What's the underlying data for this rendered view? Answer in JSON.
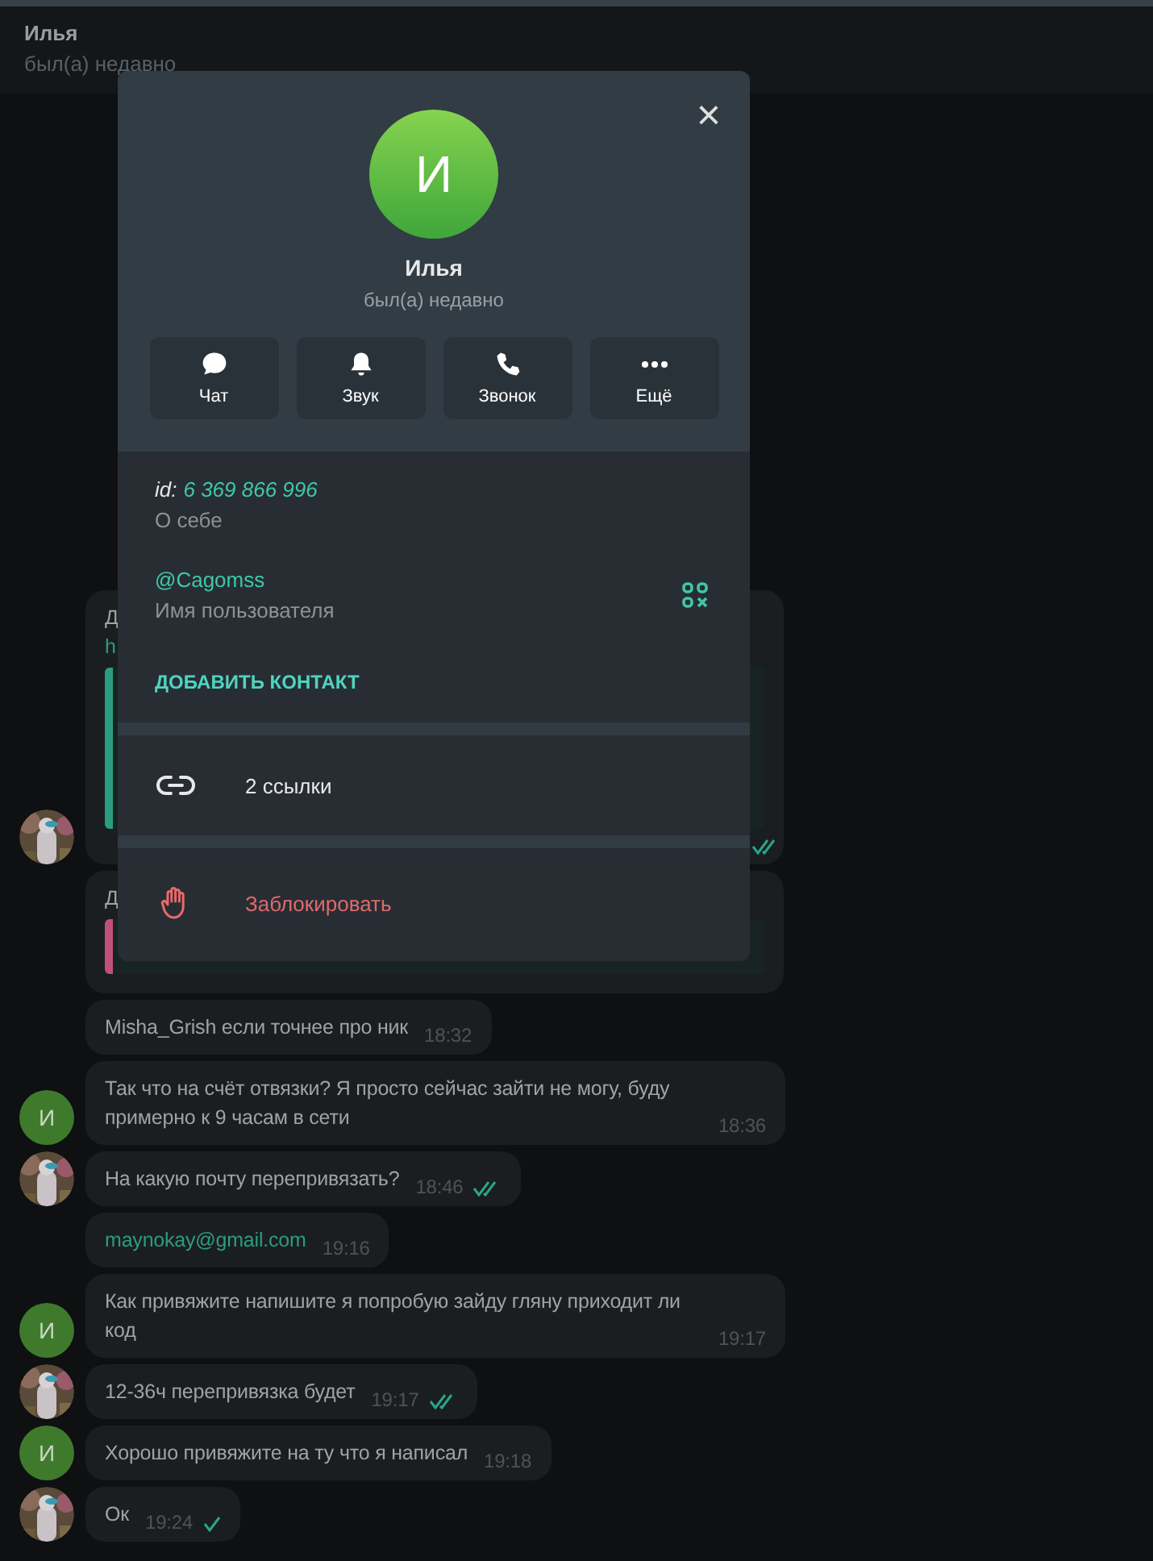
{
  "header": {
    "name": "Илья",
    "status": "был(а) недавно"
  },
  "messages": [
    {
      "text": "Д",
      "link": "h",
      "quote": {
        "color": "#2a9d7f"
      },
      "read": true
    },
    {
      "text": "Д",
      "quote": {
        "color": "#c0507a"
      }
    },
    {
      "text": "Misha_Grish если точнее про ник",
      "time": "18:32"
    },
    {
      "text": "Так что на счёт отвязки? Я просто сейчас зайти не могу, буду примерно к 9 часам в сети",
      "time": "18:36",
      "avatar": {
        "kind": "letter",
        "letter": "И"
      }
    },
    {
      "text": "На какую почту перепривязать?",
      "time": "18:46",
      "read": true
    },
    {
      "link": "maynokay@gmail.com",
      "time": "19:16"
    },
    {
      "text": "Как привяжите напишите я попробую зайду гляну приходит ли код",
      "time": "19:17",
      "avatar": {
        "kind": "letter",
        "letter": "И"
      }
    },
    {
      "text": "12-36ч перепривязка будет",
      "time": "19:17",
      "read": true
    },
    {
      "text": "Хорошо привяжите на ту что я написал",
      "time": "19:18",
      "avatar": {
        "kind": "letter",
        "letter": "И"
      }
    },
    {
      "text": "Ок",
      "time": "19:24",
      "read": false
    }
  ],
  "profile": {
    "close": "×",
    "avatar_letter": "И",
    "name": "Илья",
    "status": "был(а) недавно",
    "actions": [
      {
        "kind": "chat",
        "label": "Чат"
      },
      {
        "kind": "bell",
        "label": "Звук"
      },
      {
        "kind": "phone",
        "label": "Звонок"
      },
      {
        "kind": "more",
        "label": "Ещё"
      }
    ],
    "id_label": "id:",
    "id_value": "6 369 866 996",
    "bio_label": "О себе",
    "username": "@Cagomss",
    "username_label": "Имя пользователя",
    "add_contact": "ДОБАВИТЬ КОНТАКТ",
    "links": "2 ссылки",
    "block": "Заблокировать"
  }
}
